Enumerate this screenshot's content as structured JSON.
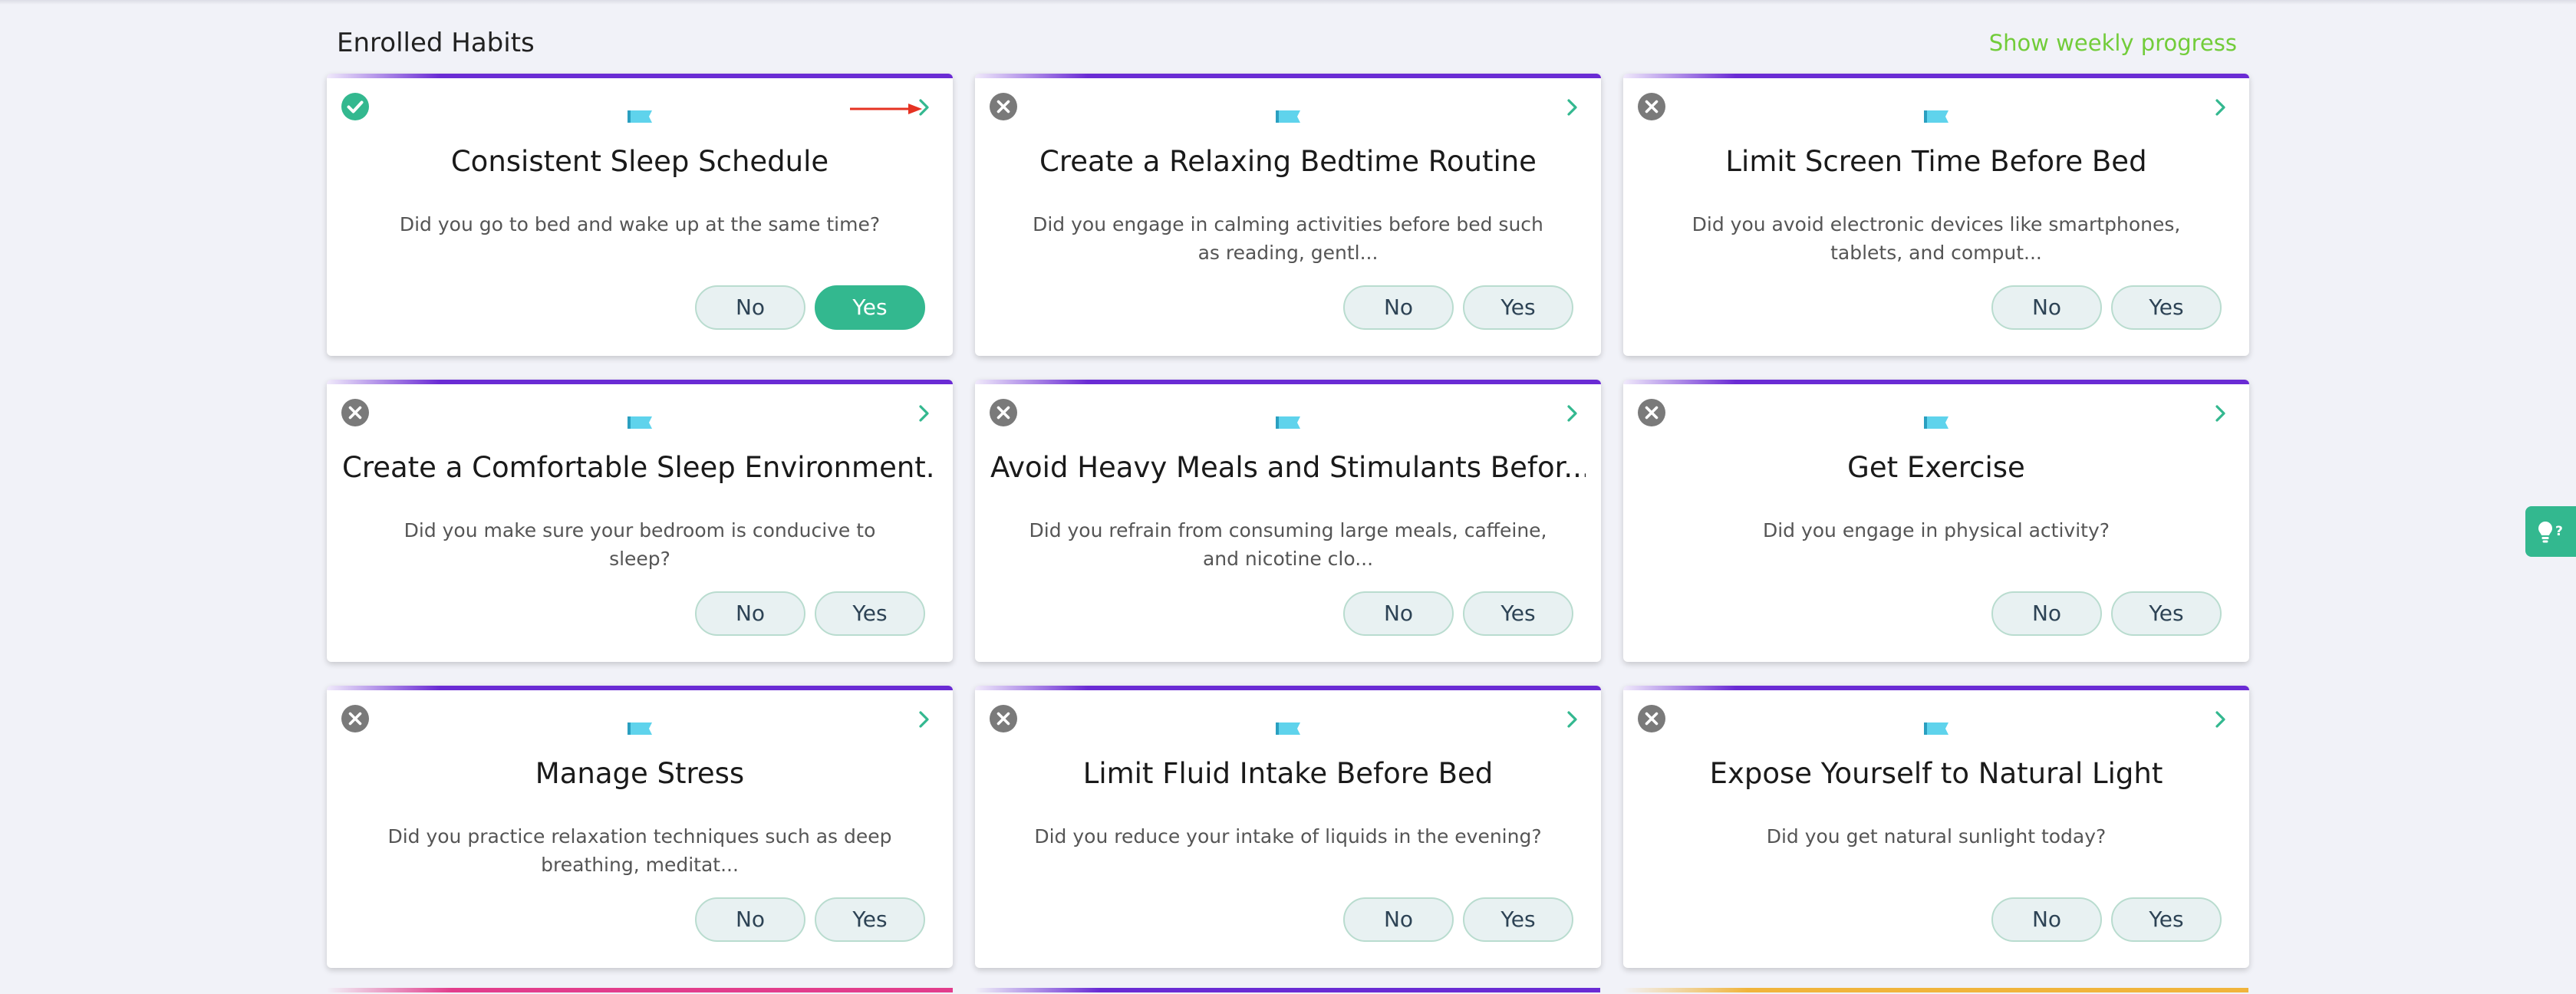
{
  "section": {
    "title": "Enrolled Habits",
    "weekly_link": "Show weekly progress"
  },
  "habits": [
    {
      "title": "Consistent Sleep Schedule",
      "question": "Did you go to bed and wake up at the same time?",
      "status": "completed",
      "no_label": "No",
      "yes_label": "Yes",
      "selected": "Yes"
    },
    {
      "title": "Create a Relaxing Bedtime Routine",
      "question": "Did you engage in calming activities before bed such as reading, gentl...",
      "status": "incomplete",
      "no_label": "No",
      "yes_label": "Yes",
      "selected": ""
    },
    {
      "title": "Limit Screen Time Before Bed",
      "question": "Did you avoid electronic devices like smartphones, tablets, and comput...",
      "status": "incomplete",
      "no_label": "No",
      "yes_label": "Yes",
      "selected": ""
    },
    {
      "title": "Create a Comfortable Sleep Environment...",
      "question": "Did you make sure your bedroom is conducive to sleep?",
      "status": "incomplete",
      "no_label": "No",
      "yes_label": "Yes",
      "selected": ""
    },
    {
      "title": "Avoid Heavy Meals and Stimulants Befor...",
      "question": "Did you refrain from consuming large meals, caffeine, and nicotine clo...",
      "status": "incomplete",
      "no_label": "No",
      "yes_label": "Yes",
      "selected": ""
    },
    {
      "title": "Get Exercise",
      "question": "Did you engage in physical activity?",
      "status": "incomplete",
      "no_label": "No",
      "yes_label": "Yes",
      "selected": ""
    },
    {
      "title": "Manage Stress",
      "question": "Did you practice relaxation techniques such as deep breathing, meditat...",
      "status": "incomplete",
      "no_label": "No",
      "yes_label": "Yes",
      "selected": ""
    },
    {
      "title": "Limit Fluid Intake Before Bed",
      "question": "Did you reduce your intake of liquids in the evening?",
      "status": "incomplete",
      "no_label": "No",
      "yes_label": "Yes",
      "selected": ""
    },
    {
      "title": "Expose Yourself to Natural Light",
      "question": "Did you get natural sunlight today?",
      "status": "incomplete",
      "no_label": "No",
      "yes_label": "Yes",
      "selected": ""
    }
  ],
  "icons": {
    "completed": "check-circle-icon",
    "incomplete": "x-circle-icon",
    "card_flag": "flag-icon",
    "open": "chevron-right-icon",
    "help": "lightbulb-question-icon"
  },
  "colors": {
    "accent_green": "#33b88f",
    "link_green": "#72cc3a",
    "card_top_purple": "#6a2bd4",
    "flag_blue": "#5fd3ec",
    "incomplete_gray": "#7a7a7a",
    "annotation_red": "#e53222"
  },
  "next_row_accents": [
    "#e23d8c",
    "#6a2bd4",
    "#f0b43c"
  ]
}
